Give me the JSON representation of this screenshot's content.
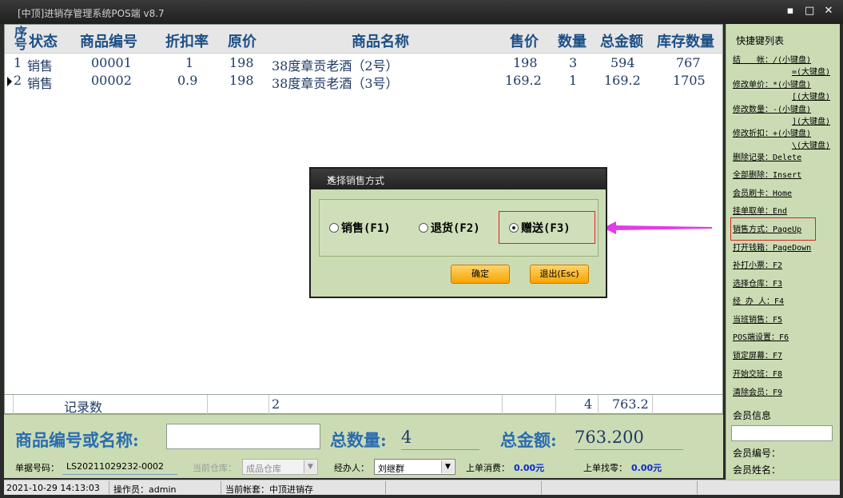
{
  "window": {
    "title": "[中顶]进销存管理系统POS端 v8.7",
    "min": "▪",
    "max": "□",
    "close": "✕"
  },
  "grid": {
    "headers": {
      "seq": "序号",
      "status": "状态",
      "code": "商品编号",
      "discount": "折扣率",
      "orig_price": "原价",
      "name": "商品名称",
      "price": "售价",
      "qty": "数量",
      "total": "总金额",
      "stock": "库存数量"
    },
    "rows": [
      {
        "seq": "1",
        "status": "销售",
        "code": "00001",
        "discount": "1",
        "orig_price": "198",
        "name": "38度章贡老酒（2号）",
        "price": "198",
        "qty": "3",
        "total": "594",
        "stock": "767"
      },
      {
        "seq": "2",
        "status": "销售",
        "code": "00002",
        "discount": "0.9",
        "orig_price": "198",
        "name": "38度章贡老酒（3号）",
        "price": "169.2",
        "qty": "1",
        "total": "169.2",
        "stock": "1705"
      }
    ],
    "footer": {
      "label": "记录数",
      "count": "2",
      "qty": "4",
      "total": "763.2"
    }
  },
  "shortcuts": {
    "title": "快捷键列表",
    "items": [
      {
        "label": "结　　帐：/(小键盘)",
        "label2": "=(大键盘)"
      },
      {
        "label": "修改单价：*(小键盘)",
        "label2": "[(大键盘)"
      },
      {
        "label": "修改数量：-(小键盘)",
        "label2": "](大键盘)"
      },
      {
        "label": "修改折扣：+(小键盘)",
        "label2": "\\(大键盘)"
      },
      {
        "label": "删除记录：Delete"
      },
      {
        "label": "全部删除：Insert"
      },
      {
        "label": "会员刷卡：Home"
      },
      {
        "label": "挂单取单：End"
      },
      {
        "label": "销售方式：PageUp"
      },
      {
        "label": "打开钱箱：PageDown"
      },
      {
        "label": "补打小票：F2"
      },
      {
        "label": "选择仓库：F3"
      },
      {
        "label": "经 办 人：F4"
      },
      {
        "label": "当班销售：F5"
      },
      {
        "label": "POS端设置：F6"
      },
      {
        "label": "锁定屏幕：F7"
      },
      {
        "label": "开始交班：F8"
      },
      {
        "label": "清除会员：F9"
      }
    ]
  },
  "member": {
    "title": "会员信息",
    "number_label": "会员编号：",
    "name_label": "会员姓名："
  },
  "entry": {
    "code_label": "商品编号或名称:",
    "code_value": "",
    "qty_label": "总数量:",
    "qty_value": "4",
    "amount_label": "总金额:",
    "amount_value": "763.200"
  },
  "info": {
    "doc_label": "单据号码：",
    "doc_value": "LS20211029232-0002",
    "warehouse_label": "当前仓库：",
    "warehouse_value": "成品仓库",
    "handler_label": "经办人：",
    "handler_value": "刘继群",
    "last_spend_label": "上单消费：",
    "last_spend_value": "0.00元",
    "last_change_label": "上单找零：",
    "last_change_value": "0.00元"
  },
  "status": {
    "datetime": "2021-10-29 14:13:03",
    "operator": "操作员：admin",
    "account": "当前帐套：中顶进销存"
  },
  "dialog": {
    "title": "选择销售方式",
    "close": "×",
    "options": [
      {
        "label": "销售(F1)",
        "selected": false
      },
      {
        "label": "退货(F2)",
        "selected": false
      },
      {
        "label": "赠送(F3)",
        "selected": true
      }
    ],
    "ok": "确定",
    "exit": "退出(Esc)"
  },
  "colors": {
    "panel": "#cbdcb4",
    "header_text": "#1c4f86",
    "highlight": "#e02020",
    "arrow": "#e23be8",
    "button": "#f6a400"
  }
}
